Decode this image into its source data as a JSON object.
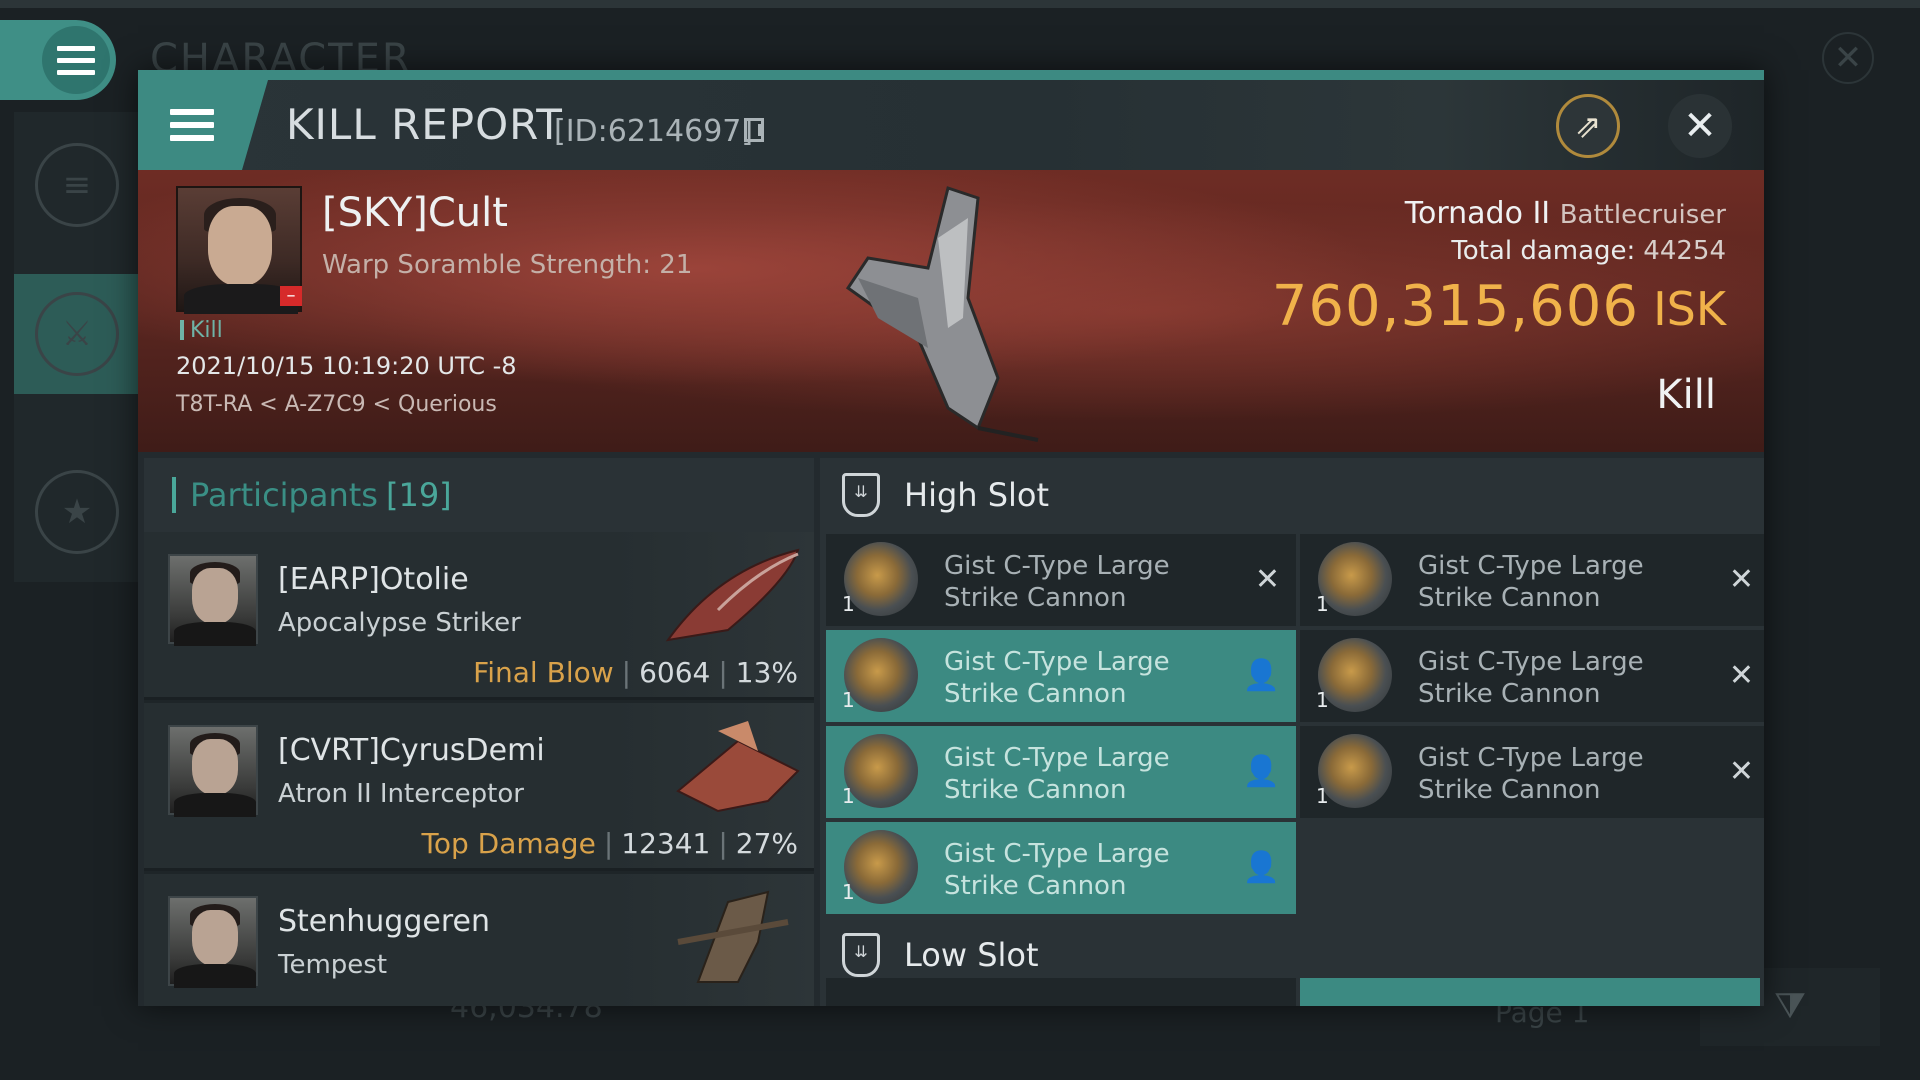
{
  "background": {
    "title": "CHARACTER",
    "bottom_amount": "46,034.78",
    "page_label": "Page 1"
  },
  "header": {
    "title": "KILL REPORT",
    "id_text": "[ID:6214697]"
  },
  "victim": {
    "name": "[SKY]Cult",
    "subtitle": "Warp Soramble Strength: 21",
    "tag": "Kill",
    "datetime": "2021/10/15 10:19:20 UTC -8",
    "location": "T8T-RA < A-Z7C9 < Querious",
    "badge": "–"
  },
  "ship": {
    "name": "Tornado II",
    "class": "Battlecruiser",
    "total_damage_label": "Total damage:",
    "total_damage": "44254",
    "isk_value": "760,315,606",
    "isk_unit": "ISK",
    "report_type": "Kill"
  },
  "participants": {
    "label": "Participants",
    "count": "[19]",
    "rows": [
      {
        "name": "[EARP]Otolie",
        "ship": "Apocalypse Striker",
        "tag": "Final Blow",
        "damage": "6064",
        "percent": "13%"
      },
      {
        "name": "[CVRT]CyrusDemi",
        "ship": "Atron II Interceptor",
        "tag": "Top Damage",
        "damage": "12341",
        "percent": "27%"
      },
      {
        "name": "Stenhuggeren",
        "ship": "Tempest",
        "tag": "",
        "damage": "",
        "percent": ""
      }
    ]
  },
  "slots": {
    "high_label": "High Slot",
    "low_label": "Low Slot",
    "high_modules": [
      {
        "name": "Gist C-Type Large Strike Cannon",
        "qty": "1",
        "status": "destroyed"
      },
      {
        "name": "Gist C-Type Large Strike Cannon",
        "qty": "1",
        "status": "destroyed"
      },
      {
        "name": "Gist C-Type Large Strike Cannon",
        "qty": "1",
        "status": "dropped"
      },
      {
        "name": "Gist C-Type Large Strike Cannon",
        "qty": "1",
        "status": "destroyed"
      },
      {
        "name": "Gist C-Type Large Strike Cannon",
        "qty": "1",
        "status": "dropped"
      },
      {
        "name": "Gist C-Type Large Strike Cannon",
        "qty": "1",
        "status": "destroyed"
      },
      {
        "name": "Gist C-Type Large Strike Cannon",
        "qty": "1",
        "status": "dropped"
      }
    ],
    "status_icons": {
      "destroyed": "close-icon",
      "dropped": "person-icon"
    }
  },
  "colors": {
    "accent": "#3d8a82",
    "isk": "#f0b24a",
    "tag": "#d9a24a"
  }
}
